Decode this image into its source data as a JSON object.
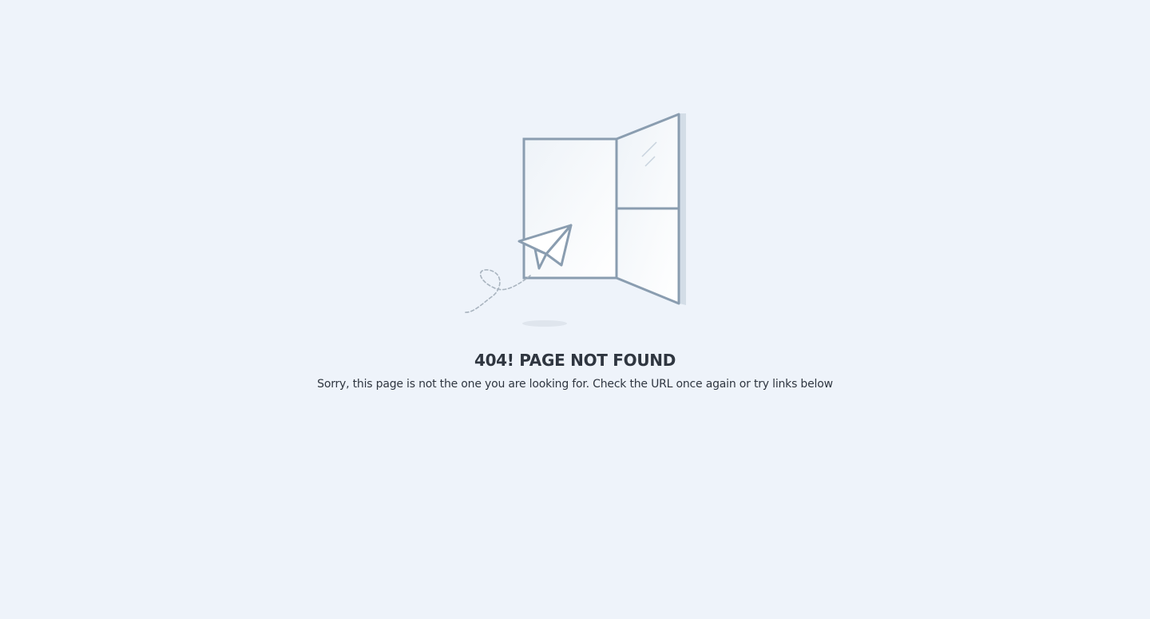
{
  "error": {
    "title": "404! PAGE NOT FOUND",
    "message": "Sorry, this page is not the one you are looking for. Check the URL once again or try links below"
  },
  "illustration": {
    "icon": "open-window-paper-plane-icon",
    "stroke_color": "#8a9db0",
    "fill_color": "#f7fafd",
    "shadow_color": "#d3dde7",
    "background_color": "#eef3fa",
    "text_color": "#2f3640"
  }
}
